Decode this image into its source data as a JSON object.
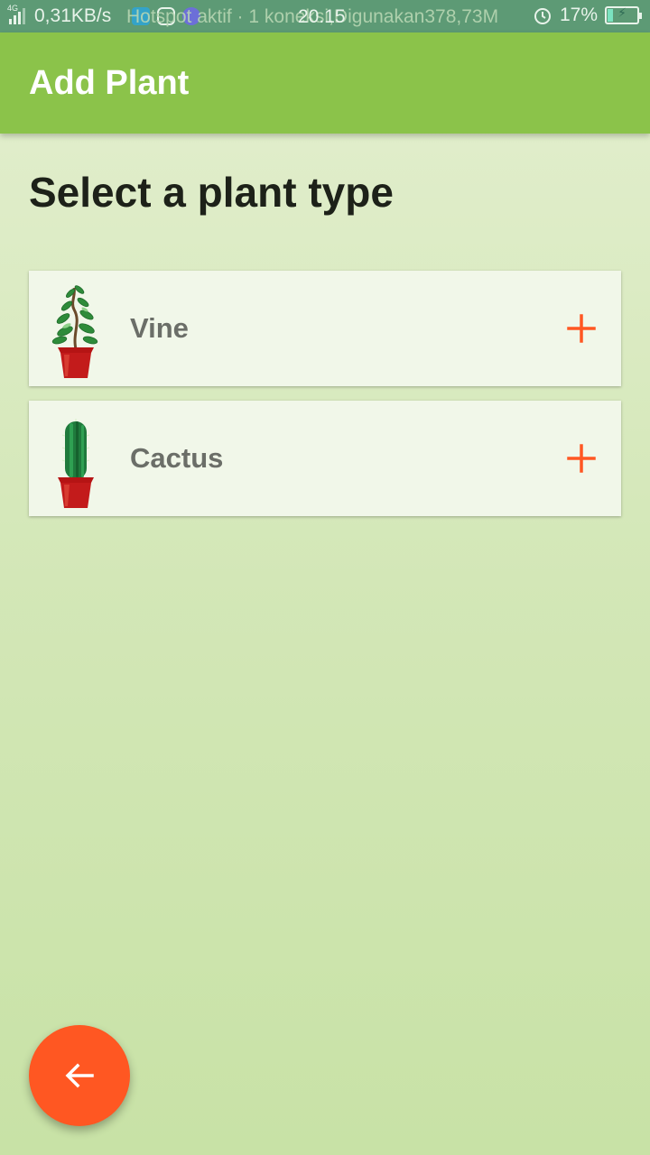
{
  "status_bar": {
    "network_type": "4G",
    "speed": "0,31KB/s",
    "overlay_text": "Hotspot aktif · 1 koneksi,Digunakan378,73M",
    "time": "20.15",
    "battery_percent": "17%",
    "battery_level": 0.17
  },
  "app_bar": {
    "title": "Add Plant"
  },
  "main": {
    "heading": "Select a plant type",
    "plants": [
      {
        "name": "Vine",
        "icon": "vine-plant-icon",
        "action_icon": "plus-icon"
      },
      {
        "name": "Cactus",
        "icon": "cactus-plant-icon",
        "action_icon": "plus-icon"
      }
    ]
  },
  "fab": {
    "icon": "arrow-back-icon"
  },
  "colors": {
    "app_bar": "#8bc34a",
    "accent": "#ff5722",
    "status_bar": "#5d9a75"
  }
}
